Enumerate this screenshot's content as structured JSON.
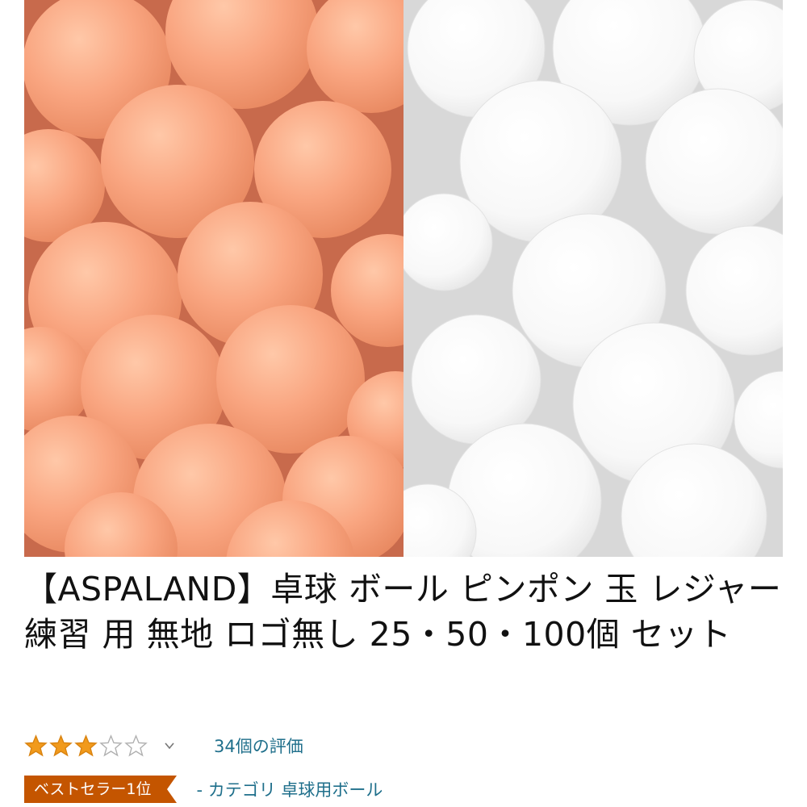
{
  "product": {
    "title": "【ASPALAND】卓球 ボール ピンポン 玉 レジャー 練習 用 無地 ロゴ無し 25・50・100個 セット",
    "image_icon": "ping-pong-balls-photo",
    "colors": {
      "orange_ball": "#f7a27e",
      "white_ball": "#fbfbfb",
      "badge": "#c45500",
      "link": "#1f6f8b",
      "star": "#f19a1c"
    }
  },
  "rating": {
    "stars_filled": 3,
    "stars_total": 5,
    "count_text": "34個の評価"
  },
  "badge": {
    "label": "ベストセラー1位",
    "category_text": "- カテゴリ 卓球用ボール"
  }
}
